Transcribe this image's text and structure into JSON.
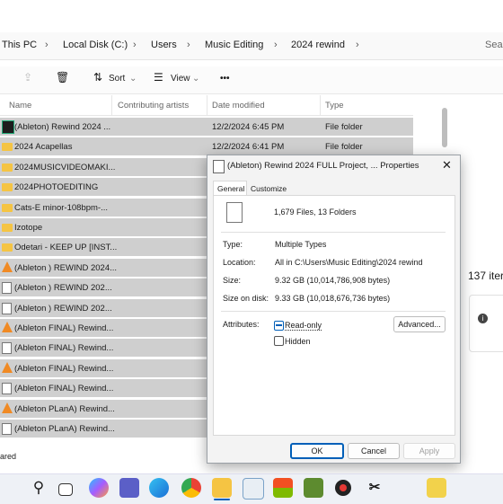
{
  "breadcrumb": {
    "items": [
      "This PC",
      "Local Disk (C:)",
      "Users",
      "Music Editing",
      "2024 rewind"
    ],
    "search_placeholder": "Sear"
  },
  "toolbar": {
    "sort": "Sort",
    "view": "View",
    "more": "•••"
  },
  "columns": {
    "name": "Name",
    "artists": "Contributing artists",
    "date": "Date modified",
    "type": "Type"
  },
  "files": [
    {
      "name": "(Ableton) Rewind 2024 ...",
      "date": "12/2/2024 6:45 PM",
      "type": "File folder",
      "icon": "ableton-folder-icon"
    },
    {
      "name": "2024 Acapellas",
      "date": "12/2/2024 6:41 PM",
      "type": "File folder",
      "icon": "folder-icon"
    },
    {
      "name": "2024MUSICVIDEOMAKI...",
      "date": "",
      "type": "",
      "icon": "folder-icon"
    },
    {
      "name": "2024PHOTOEDITING",
      "date": "",
      "type": "",
      "icon": "folder-icon"
    },
    {
      "name": "Cats-E minor-108bpm-...",
      "date": "",
      "type": "",
      "icon": "folder-icon"
    },
    {
      "name": "Izotope",
      "date": "",
      "type": "",
      "icon": "folder-icon"
    },
    {
      "name": "Odetari - KEEP UP [INST...",
      "date": "",
      "type": "",
      "icon": "folder-icon"
    },
    {
      "name": "(Ableton ) REWIND 2024...",
      "date": "",
      "type": "",
      "icon": "vlc-icon"
    },
    {
      "name": "(Ableton ) REWIND 202...",
      "date": "",
      "type": "",
      "icon": "document-icon"
    },
    {
      "name": "(Ableton ) REWIND 202...",
      "date": "",
      "type": "",
      "icon": "document-icon"
    },
    {
      "name": "(Ableton FINAL) Rewind...",
      "date": "",
      "type": "",
      "icon": "vlc-icon"
    },
    {
      "name": "(Ableton FINAL) Rewind...",
      "date": "",
      "type": "",
      "icon": "document-icon"
    },
    {
      "name": "(Ableton FINAL) Rewind...",
      "date": "",
      "type": "",
      "icon": "vlc-icon"
    },
    {
      "name": "(Ableton FINAL) Rewind...",
      "date": "",
      "type": "",
      "icon": "document-icon"
    },
    {
      "name": "(Ableton PLanA) Rewind...",
      "date": "",
      "type": "",
      "icon": "vlc-icon"
    },
    {
      "name": "(Ableton PLanA) Rewind...",
      "date": "",
      "type": "",
      "icon": "document-icon"
    }
  ],
  "details_pane": {
    "count": "137 iter"
  },
  "status": {
    "left": "ared"
  },
  "dialog": {
    "title": "(Ableton) Rewind 2024 FULL Project, ... Properties",
    "tabs": [
      "General",
      "Customize"
    ],
    "summary": "1,679 Files, 13 Folders",
    "type_label": "Type:",
    "type_value": "Multiple Types",
    "location_label": "Location:",
    "location_value": "All in C:\\Users\\Music Editing\\2024 rewind",
    "size_label": "Size:",
    "size_value": "9.32 GB (10,014,786,908 bytes)",
    "size_on_disk_label": "Size on disk:",
    "size_on_disk_value": "9.33 GB (10,018,676,736 bytes)",
    "attributes_label": "Attributes:",
    "readonly_label": "Read-only",
    "hidden_label": "Hidden",
    "advanced_label": "Advanced...",
    "ok": "OK",
    "cancel": "Cancel",
    "apply": "Apply"
  },
  "colors": {
    "selection": "#cfcfcf",
    "accent": "#005fb8",
    "folder": "#f5c443"
  }
}
